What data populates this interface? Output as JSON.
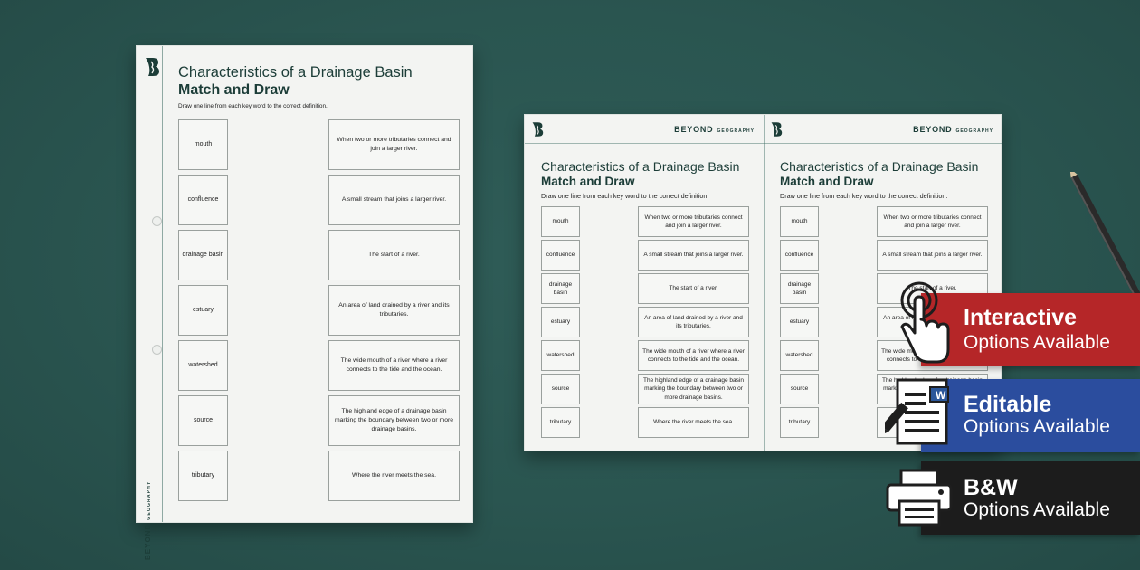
{
  "worksheet": {
    "title": "Characteristics of a Drainage Basin",
    "subtitle": "Match and Draw",
    "instruction": "Draw one line from each key word to the correct definition.",
    "brand": "BEYOND",
    "brand_sub": "GEOGRAPHY",
    "keywords": [
      "mouth",
      "confluence",
      "drainage basin",
      "estuary",
      "watershed",
      "source",
      "tributary"
    ],
    "definitions": [
      "When two or more tributaries connect and join a larger river.",
      "A small stream that joins a larger river.",
      "The start of a river.",
      "An area of land drained by a river and its tributaries.",
      "The wide mouth of a river where a river connects to the tide and the ocean.",
      "The highland edge of a drainage basin marking the boundary between two or more drainage basins.",
      "Where the river meets the sea."
    ]
  },
  "options": {
    "interactive": {
      "title": "Interactive",
      "subtitle": "Options Available",
      "color": "#b52628",
      "icon": "touch-hand-icon"
    },
    "editable": {
      "title": "Editable",
      "subtitle": "Options Available",
      "color": "#2b4d9e",
      "icon": "word-document-icon"
    },
    "bw": {
      "title": "B&W",
      "subtitle": "Options Available",
      "color": "#1c1c1c",
      "icon": "printer-icon"
    }
  },
  "colors": {
    "background": "#2a5550",
    "brand_green": "#1c3d38"
  }
}
